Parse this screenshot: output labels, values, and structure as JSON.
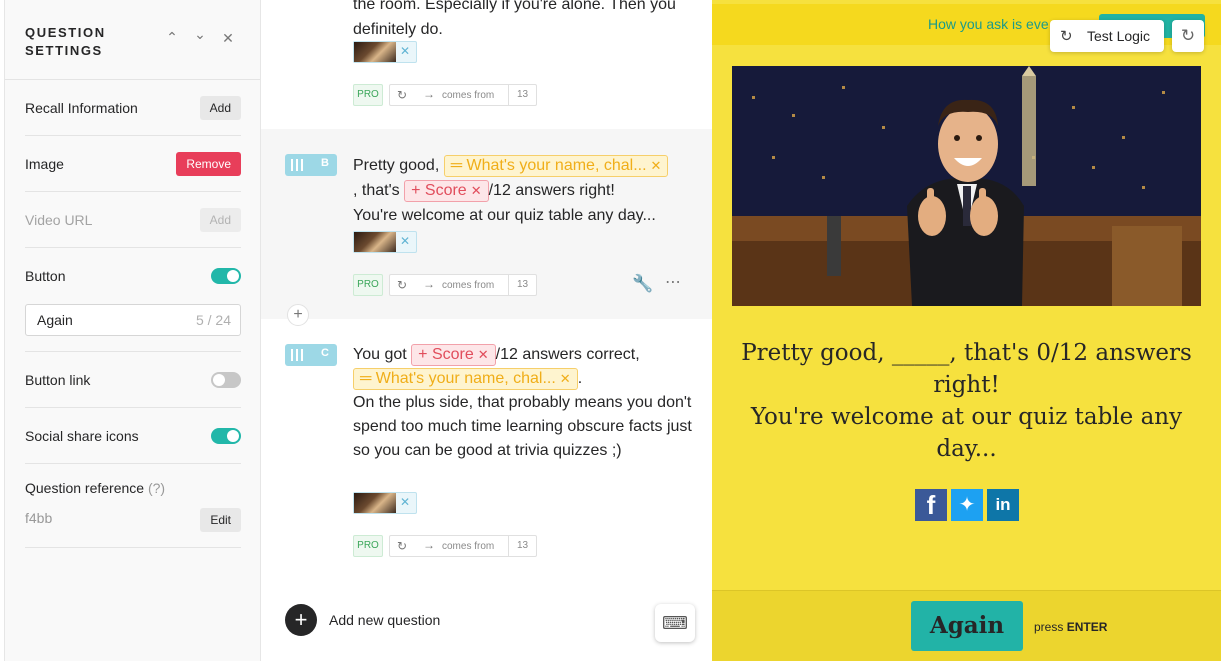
{
  "settings": {
    "title": "QUESTION SETTINGS",
    "recall_label": "Recall Information",
    "recall_btn": "Add",
    "image_label": "Image",
    "image_btn": "Remove",
    "video_label": "Video URL",
    "video_btn": "Add",
    "button_label": "Button",
    "button_toggle": true,
    "button_text_value": "Again",
    "button_text_count": "5 / 24",
    "button_link_label": "Button link",
    "button_link_toggle": false,
    "social_label": "Social share icons",
    "social_toggle": true,
    "ref_label": "Question reference",
    "ref_hint": "(?)",
    "ref_value": "f4bb",
    "ref_btn": "Edit"
  },
  "editor": {
    "card_a": {
      "line1": "the room. Especially if you're alone. Then you",
      "line2": "definitely do.",
      "pro": "PRO",
      "comes_from": "comes from",
      "count": "13"
    },
    "card_b": {
      "letter": "B",
      "t1": "Pretty good,",
      "var": "What's your name, chal...",
      "t2": ", that's",
      "score": "Score",
      "t3": "/12 answers right!",
      "t4": "You're welcome at our quiz table any day...",
      "pro": "PRO",
      "comes_from": "comes from",
      "count": "13"
    },
    "card_c": {
      "letter": "C",
      "t1": "You got",
      "score": "Score",
      "t2": "/12 answers correct,",
      "var": "What's your name, chal...",
      "t3": ".",
      "t4": "On the plus side, that probably means you don't spend too much time learning obscure facts just so you can be good at trivia quizzes ;)",
      "pro": "PRO",
      "comes_from": "comes from",
      "count": "13"
    },
    "add_question": "Add new question"
  },
  "preview": {
    "banner_text": "How you ask is eve",
    "test_logic": "Test Logic",
    "message_l1": "Pretty good, _____, that's 0/12 answers right!",
    "message_l2": "You're welcome at our quiz table any day...",
    "again_btn": "Again",
    "press": "press",
    "enter": "ENTER"
  },
  "colors": {
    "accent_teal": "#22b3a7",
    "preview_bg": "#f6e13e",
    "remove_red": "#e83e5a"
  }
}
